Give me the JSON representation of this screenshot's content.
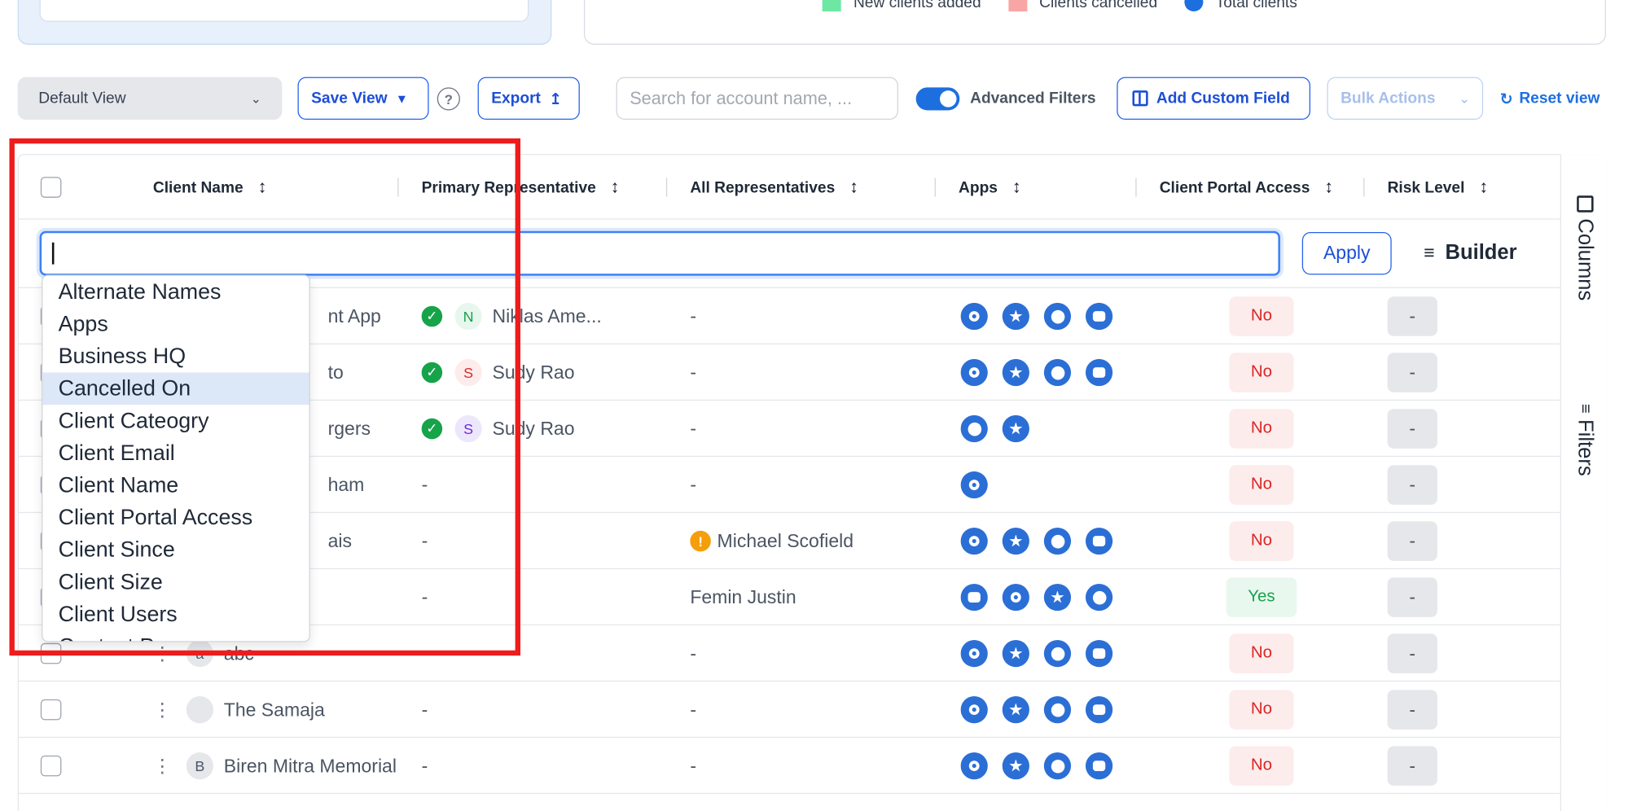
{
  "legend": [
    {
      "label": "New clients added",
      "color": "#6ee7a2",
      "shape": "square"
    },
    {
      "label": "Clients cancelled",
      "color": "#f8a5a5",
      "shape": "square"
    },
    {
      "label": "Total clients",
      "color": "#1d6fe0",
      "shape": "dot"
    }
  ],
  "toolbar": {
    "default_view": "Default View",
    "save_view": "Save View",
    "help": "?",
    "export": "Export",
    "search_placeholder": "Search for account name, ...",
    "advanced_filters": "Advanced Filters",
    "add_custom_field": "Add Custom Field",
    "bulk_actions": "Bulk Actions",
    "reset_view": "Reset view"
  },
  "columns": {
    "client_name": "Client Name",
    "primary_rep": "Primary Representative",
    "all_reps": "All Representatives",
    "apps": "Apps",
    "portal": "Client Portal Access",
    "risk": "Risk Level"
  },
  "filter": {
    "apply": "Apply",
    "builder": "Builder"
  },
  "rail": {
    "columns": "Columns",
    "filters": "Filters"
  },
  "dropdown": {
    "options": [
      "Alternate Names",
      "Apps",
      "Business HQ",
      "Cancelled On",
      "Client Cateogry",
      "Client Email",
      "Client Name",
      "Client Portal Access",
      "Client Since",
      "Client Size",
      "Client Users",
      "Contact P..."
    ],
    "active_index": 3
  },
  "rows": [
    {
      "client": "nt App",
      "rep_name": "Niklas Ame...",
      "rep_initial": "N",
      "rep_color": "#e8f7ee",
      "rep_text": "#16a34a",
      "all_reps": "-",
      "apps": [
        "a",
        "b",
        "c",
        "d"
      ],
      "portal": "No",
      "risk": "-"
    },
    {
      "client": "to",
      "rep_name": "Sudy Rao",
      "rep_initial": "S",
      "rep_color": "#fdecec",
      "rep_text": "#dc2626",
      "all_reps": "-",
      "apps": [
        "a",
        "b",
        "c",
        "d"
      ],
      "portal": "No",
      "risk": "-"
    },
    {
      "client": "rgers",
      "rep_name": "Sudy Rao",
      "rep_initial": "S",
      "rep_color": "#ede7fb",
      "rep_text": "#6d28d9",
      "all_reps": "-",
      "apps": [
        "c",
        "b"
      ],
      "portal": "No",
      "risk": "-"
    },
    {
      "client": "ham",
      "rep_name": "-",
      "rep_initial": "",
      "all_reps": "-",
      "apps": [
        "a"
      ],
      "portal": "No",
      "risk": "-"
    },
    {
      "client": "ais",
      "rep_name": "-",
      "rep_initial": "",
      "all_reps": "Michael Scofield",
      "all_reps_warn": true,
      "apps": [
        "a",
        "b",
        "c",
        "d"
      ],
      "portal": "No",
      "risk": "-"
    },
    {
      "client": "",
      "rep_name": "-",
      "rep_initial": "",
      "all_reps": "Femin Justin",
      "apps": [
        "d",
        "a",
        "b",
        "c"
      ],
      "portal": "Yes",
      "risk": "-"
    },
    {
      "client": "abc",
      "client_initial": "a",
      "rep_name": "",
      "rep_initial": "",
      "all_reps": "-",
      "apps": [
        "a",
        "b",
        "c",
        "d"
      ],
      "portal": "No",
      "risk": "-"
    },
    {
      "client": "The Samaja",
      "client_initial": " ",
      "rep_name": "-",
      "rep_initial": "",
      "all_reps": "-",
      "apps": [
        "a",
        "b",
        "c",
        "d"
      ],
      "portal": "No",
      "risk": "-"
    },
    {
      "client": "Biren Mitra Memorial",
      "client_initial": "B",
      "rep_name": "-",
      "rep_initial": "",
      "all_reps": "-",
      "apps": [
        "a",
        "b",
        "c",
        "d"
      ],
      "portal": "No",
      "risk": "-"
    }
  ]
}
